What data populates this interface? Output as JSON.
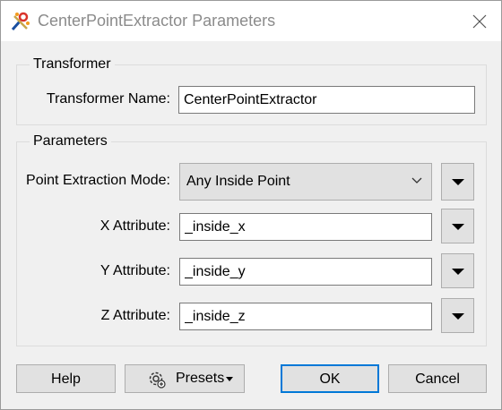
{
  "window": {
    "title": "CenterPointExtractor Parameters",
    "app_icon": "fme-transformer-icon",
    "close_icon": "close-icon"
  },
  "transformer_group": {
    "title": "Transformer",
    "name_label": "Transformer Name:",
    "name_value": "CenterPointExtractor"
  },
  "parameters_group": {
    "title": "Parameters",
    "mode_label": "Point Extraction Mode:",
    "mode_value": "Any Inside Point",
    "x_label": "X Attribute:",
    "x_value": "_inside_x",
    "y_label": "Y Attribute:",
    "y_value": "_inside_y",
    "z_label": "Z Attribute:",
    "z_value": "_inside_z"
  },
  "buttons": {
    "help": "Help",
    "presets": "Presets",
    "ok": "OK",
    "cancel": "Cancel"
  },
  "colors": {
    "accent": "#0078d7",
    "button_face": "#e1e1e1",
    "dialog_bg": "#f0f0f0"
  }
}
